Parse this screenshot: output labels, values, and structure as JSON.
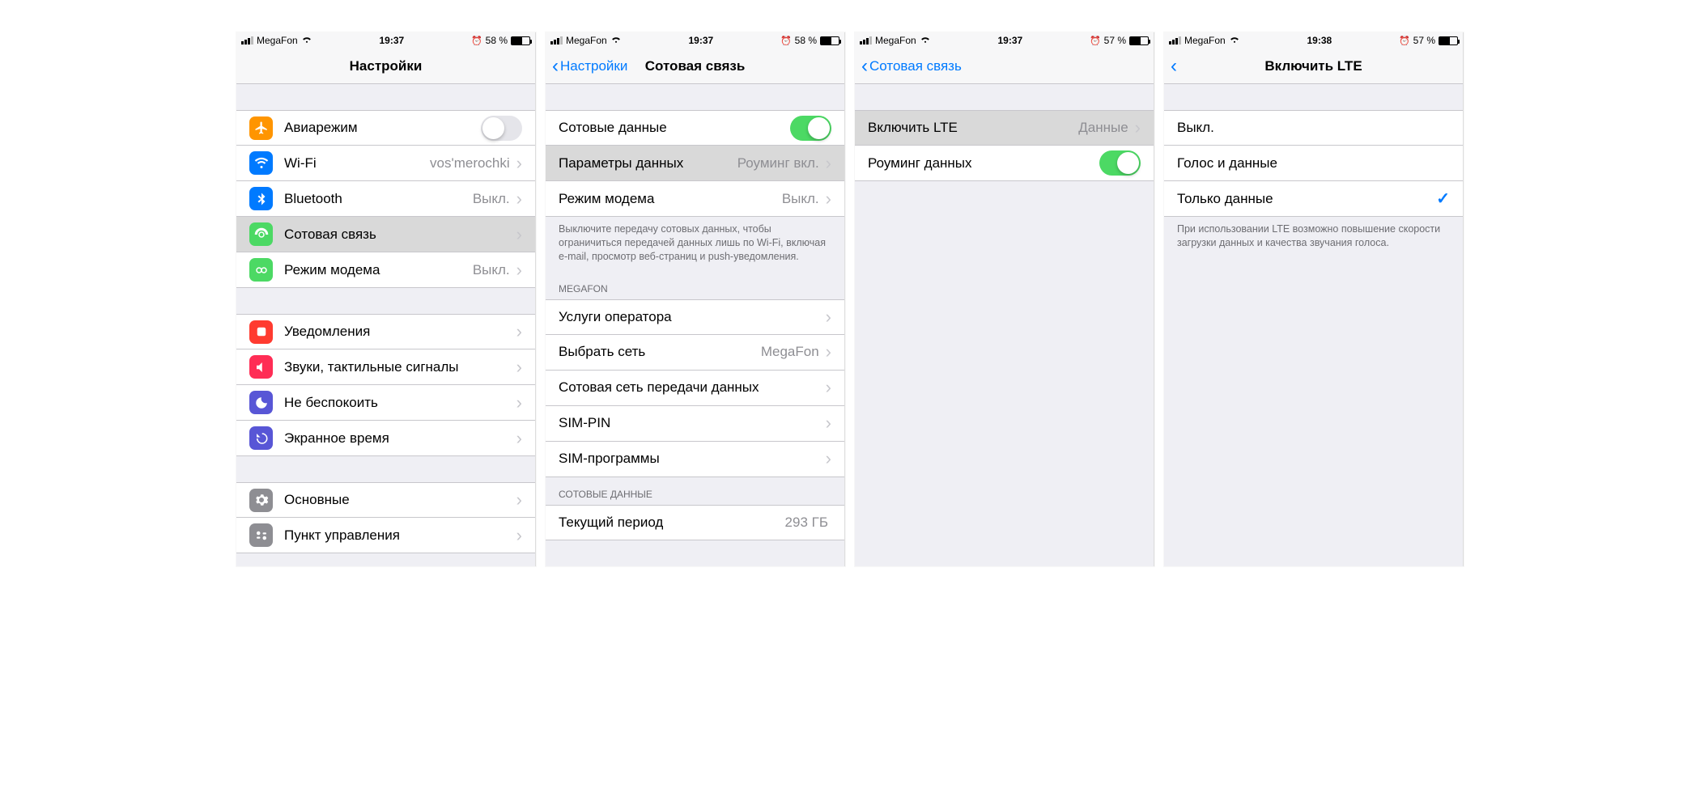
{
  "status": {
    "carrier": "MegaFon",
    "time_a": "19:37",
    "time_b": "19:37",
    "time_c": "19:37",
    "time_d": "19:38",
    "batt_a": "58 %",
    "batt_b": "58 %",
    "batt_c": "57 %",
    "batt_d": "57 %"
  },
  "screen1": {
    "title": "Настройки",
    "rows": {
      "airplane": "Авиарежим",
      "wifi": "Wi-Fi",
      "wifi_val": "vos'merochki",
      "bt": "Bluetooth",
      "bt_val": "Выкл.",
      "cellular": "Сотовая связь",
      "hotspot": "Режим модема",
      "hotspot_val": "Выкл.",
      "notifications": "Уведомления",
      "sounds": "Звуки, тактильные сигналы",
      "dnd": "Не беспокоить",
      "screentime": "Экранное время",
      "general": "Основные",
      "control": "Пункт управления"
    }
  },
  "screen2": {
    "back": "Настройки",
    "title": "Сотовая связь",
    "cellular_data": "Сотовые данные",
    "data_options": "Параметры данных",
    "data_options_val": "Роуминг вкл.",
    "hotspot": "Режим модема",
    "hotspot_val": "Выкл.",
    "note": "Выключите передачу сотовых данных, чтобы ограничиться передачей данных лишь по Wi-Fi, включая e-mail, просмотр веб-страниц и push-уведомления.",
    "carrier_header": "MEGAFON",
    "carrier_services": "Услуги оператора",
    "network_select": "Выбрать сеть",
    "network_select_val": "MegaFon",
    "cellular_network": "Сотовая сеть передачи данных",
    "sim_pin": "SIM-PIN",
    "sim_apps": "SIM-программы",
    "usage_header": "СОТОВЫЕ ДАННЫЕ",
    "current_period": "Текущий период",
    "current_period_val": "293 ГБ"
  },
  "screen3": {
    "back": "Сотовая связь",
    "enable_lte": "Включить LTE",
    "enable_lte_val": "Данные",
    "roaming": "Роуминг данных"
  },
  "screen4": {
    "title": "Включить LTE",
    "off": "Выкл.",
    "voice_data": "Голос и данные",
    "data_only": "Только данные",
    "note": "При использовании LTE возможно повышение скорости загрузки данных и качества звучания голоса."
  }
}
